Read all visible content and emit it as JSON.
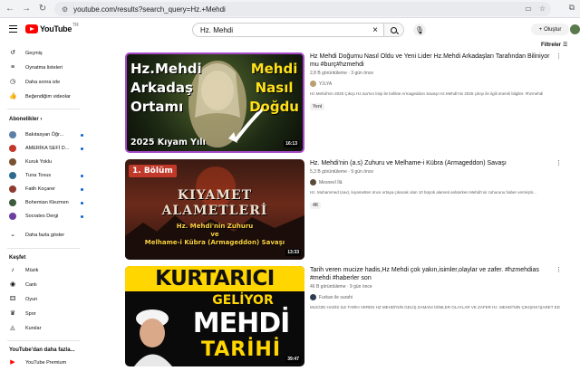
{
  "browser": {
    "url": "youtube.com/results?search_query=Hz.+Mehdi"
  },
  "masthead": {
    "logo_text": "YouTube",
    "country_code": "TR",
    "search_query": "Hz. Mehdi",
    "create_label": "Oluştur"
  },
  "sidebar": {
    "main": [
      {
        "label": "Geçmiş",
        "icon": "history-icon"
      },
      {
        "label": "Oynatma listeleri",
        "icon": "playlist-icon"
      },
      {
        "label": "Daha sonra izle",
        "icon": "clock-icon"
      },
      {
        "label": "Beğendiğim videolar",
        "icon": "thumbs-up-icon"
      }
    ],
    "subscriptions_header": "Abonelikler",
    "subscriptions": [
      {
        "label": "Bakıtasyan Öğr...",
        "color": "#5b7fa6"
      },
      {
        "label": "AMERİKA SEFİ D...",
        "color": "#c0392b"
      },
      {
        "label": "Kuruk Yoklu",
        "color": "#7a5230"
      },
      {
        "label": "Tuna Tovus",
        "color": "#2d6a8f"
      },
      {
        "label": "Fatih Koçarer",
        "color": "#8e3b2e"
      },
      {
        "label": "Bohemian Klezmen",
        "color": "#3d5a3a"
      },
      {
        "label": "Socrates Dergi",
        "color": "#6c3fa0"
      }
    ],
    "show_more": "Daha fazla göster",
    "explore_header": "Keşfet",
    "explore": [
      {
        "label": "Müzik",
        "icon": "music-icon"
      },
      {
        "label": "Canlı",
        "icon": "live-icon"
      },
      {
        "label": "Oyun",
        "icon": "gamepad-icon"
      },
      {
        "label": "Spor",
        "icon": "trophy-icon"
      },
      {
        "label": "Kurslar",
        "icon": "graduation-icon"
      }
    ],
    "more_header": "YouTube'dan daha fazla...",
    "premium": "YouTube Premium"
  },
  "filters_label": "Filtreler",
  "results": [
    {
      "title": "Hz Mehdi Doğumu Nasıl Oldu ve Yeni Lider Hz.Mehdi Arkadaşları Tarafından Biliniyor mu #burç#hzmehdi",
      "meta": "2,8 B görüntüleme · 3 gün önce",
      "channel": "Y.İLYA",
      "channel_color": "#b8a070",
      "description": "Hz Mehdi'nin 2025 Çıkışı Hz.Isa'nın İnişi ile birlikte Armageddon Savaşı Hz.Mehdi'nin 2025 çıkışı ile ilgili önemli bilgiler. #hzmehdi",
      "badge": "Yeni",
      "duration": "16:13",
      "thumb_text": {
        "left1": "Hz.Mehdi",
        "left2": "Arkadaş",
        "left3": "Ortamı",
        "right1": "Mehdi",
        "right2": "Nasıl",
        "right3": "Doğdu",
        "bottom": "2025 Kıyam Yılı"
      }
    },
    {
      "title": "Hz. Mehdi'nin (a.s) Zuhuru ve Melhame-i Kübra (Armageddon) Savaşı",
      "meta": "5,3 B görüntüleme · 9 gün önce",
      "channel": "Mesnevî İlâ",
      "channel_color": "#5b4a3a",
      "description": "Hz. Muhammed (sav), kıyametten önce ortaya çıkacak olan 10 büyük alameti anlatırken Mehdi'nin zuhurunu haber vermiştir...",
      "badge": "4K",
      "duration": "13:33",
      "thumb_text": {
        "tag": "1. Bölüm",
        "main1": "KIYAMET",
        "main2": "ALAMETLERİ",
        "sub1": "Hz. Mehdi'nin Zuhuru",
        "sub2": "ve",
        "sub3": "Melhame-i Kübra (Armageddon) Savaşı"
      }
    },
    {
      "title": "Tarih veren mucize hadis,Hz Mehdi çok yakın,isimler,olaylar ve zafer. #hzmehdias #mehdi #haberler son",
      "meta": "46 B görüntüleme · 9 gün önce",
      "channel": "Furkan ile surahi",
      "channel_color": "#2c3e50",
      "description": "MUCİZE HADİS İLE TARİH VEREN HZ MEHDİ'NİN GELİŞ ZAMANI İSİMLER OLAYLAR VE ZAFER Hz. MEHDİ'NİN ÇIKIŞINI İŞARET EDEN...",
      "duration": "39:47",
      "thumb_text": {
        "top": "KURTARICI",
        "mid": "GELİYOR",
        "main": "MEHDİ",
        "bottom": "TARİHİ"
      }
    }
  ]
}
